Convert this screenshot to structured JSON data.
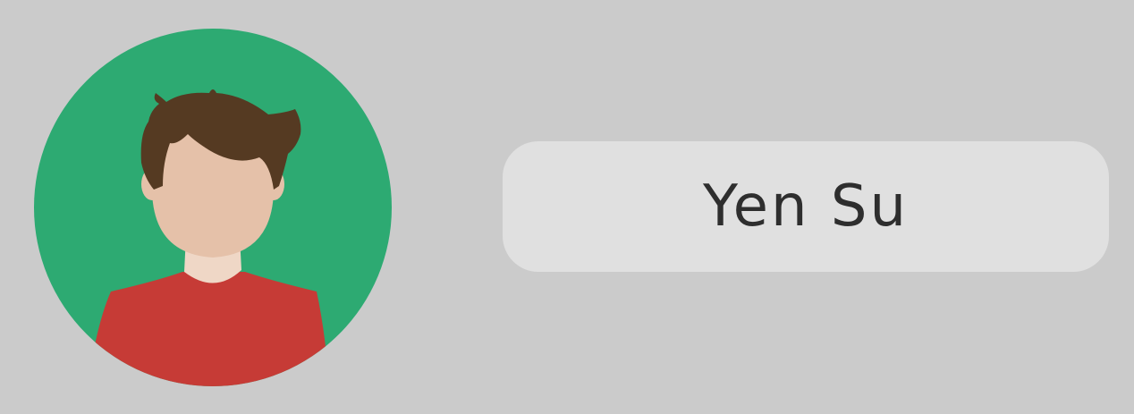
{
  "profile": {
    "name": "Yen Su",
    "avatar_icon": "user-avatar-icon"
  },
  "colors": {
    "background": "#cbcbcb",
    "avatar_circle": "#2daa72",
    "skin": "#e5c1a9",
    "neck": "#efd7c6",
    "hair": "#553a22",
    "shirt": "#c63b36",
    "pill": "#e0e0e0",
    "text": "#2e2e2e"
  }
}
